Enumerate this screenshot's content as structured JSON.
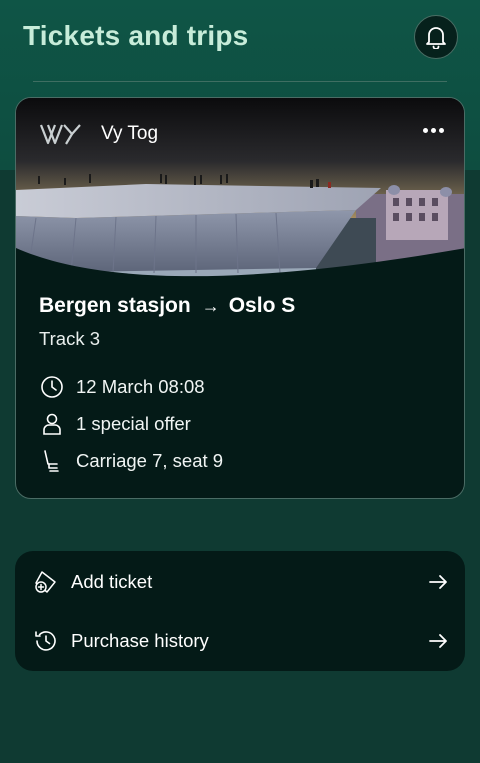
{
  "header": {
    "title": "Tickets and trips",
    "notifications_icon": "bell-icon"
  },
  "ticket": {
    "operator": "Vy Tog",
    "operator_logo": "vy-logo",
    "more_icon": "more-horizontal-icon",
    "from": "Bergen stasjon",
    "to": "Oslo S",
    "route_arrow": "→",
    "track": "Track 3",
    "details": [
      {
        "icon": "clock-icon",
        "text": "12 March 08:08"
      },
      {
        "icon": "person-icon",
        "text": "1 special offer"
      },
      {
        "icon": "seat-icon",
        "text": "Carriage 7, seat 9"
      }
    ]
  },
  "actions": [
    {
      "icon": "add-ticket-icon",
      "label": "Add ticket",
      "arrow_icon": "arrow-right-icon"
    },
    {
      "icon": "history-icon",
      "label": "Purchase history",
      "arrow_icon": "arrow-right-icon"
    }
  ],
  "colors": {
    "background": "#0f3a32",
    "header_band": "#0e4d40",
    "title": "#c7ecd9",
    "card": "#041a17",
    "border": "#4b6c65"
  }
}
